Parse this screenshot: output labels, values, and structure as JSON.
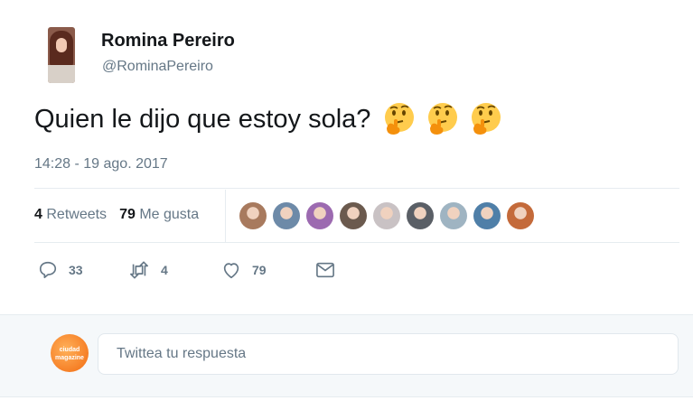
{
  "author": {
    "name": "Romina Pereiro",
    "handle": "@RominaPereiro"
  },
  "tweet": {
    "text": "Quien le dijo que estoy sola?",
    "emoji": [
      "thinking-face",
      "thinking-face",
      "thinking-face"
    ],
    "timestamp": "14:28 - 19 ago. 2017"
  },
  "stats": {
    "retweets_count": "4",
    "retweets_label": "Retweets",
    "likes_count": "79",
    "likes_label": "Me gusta"
  },
  "likers": [
    {
      "icon": "avatar",
      "color": "#a87a5e"
    },
    {
      "icon": "avatar",
      "color": "#6d8aa8"
    },
    {
      "icon": "avatar",
      "color": "#9c6ab0"
    },
    {
      "icon": "avatar",
      "color": "#6b5a4e"
    },
    {
      "icon": "avatar",
      "color": "#c9c2c4"
    },
    {
      "icon": "avatar",
      "color": "#5a5f66"
    },
    {
      "icon": "avatar",
      "color": "#9fb4c2"
    },
    {
      "icon": "avatar",
      "color": "#4f7fa8"
    },
    {
      "icon": "avatar",
      "color": "#c46a3a"
    }
  ],
  "actions": {
    "replies": "33",
    "retweets": "4",
    "likes": "79"
  },
  "reply": {
    "placeholder": "Twittea tu respuesta",
    "logo_text": "ciudad magazine"
  },
  "colors": {
    "primary_text": "#14171a",
    "secondary_text": "#657786",
    "border": "#e6ecf0",
    "background_alt": "#f5f8fa",
    "emoji": "#ffcc4d"
  }
}
